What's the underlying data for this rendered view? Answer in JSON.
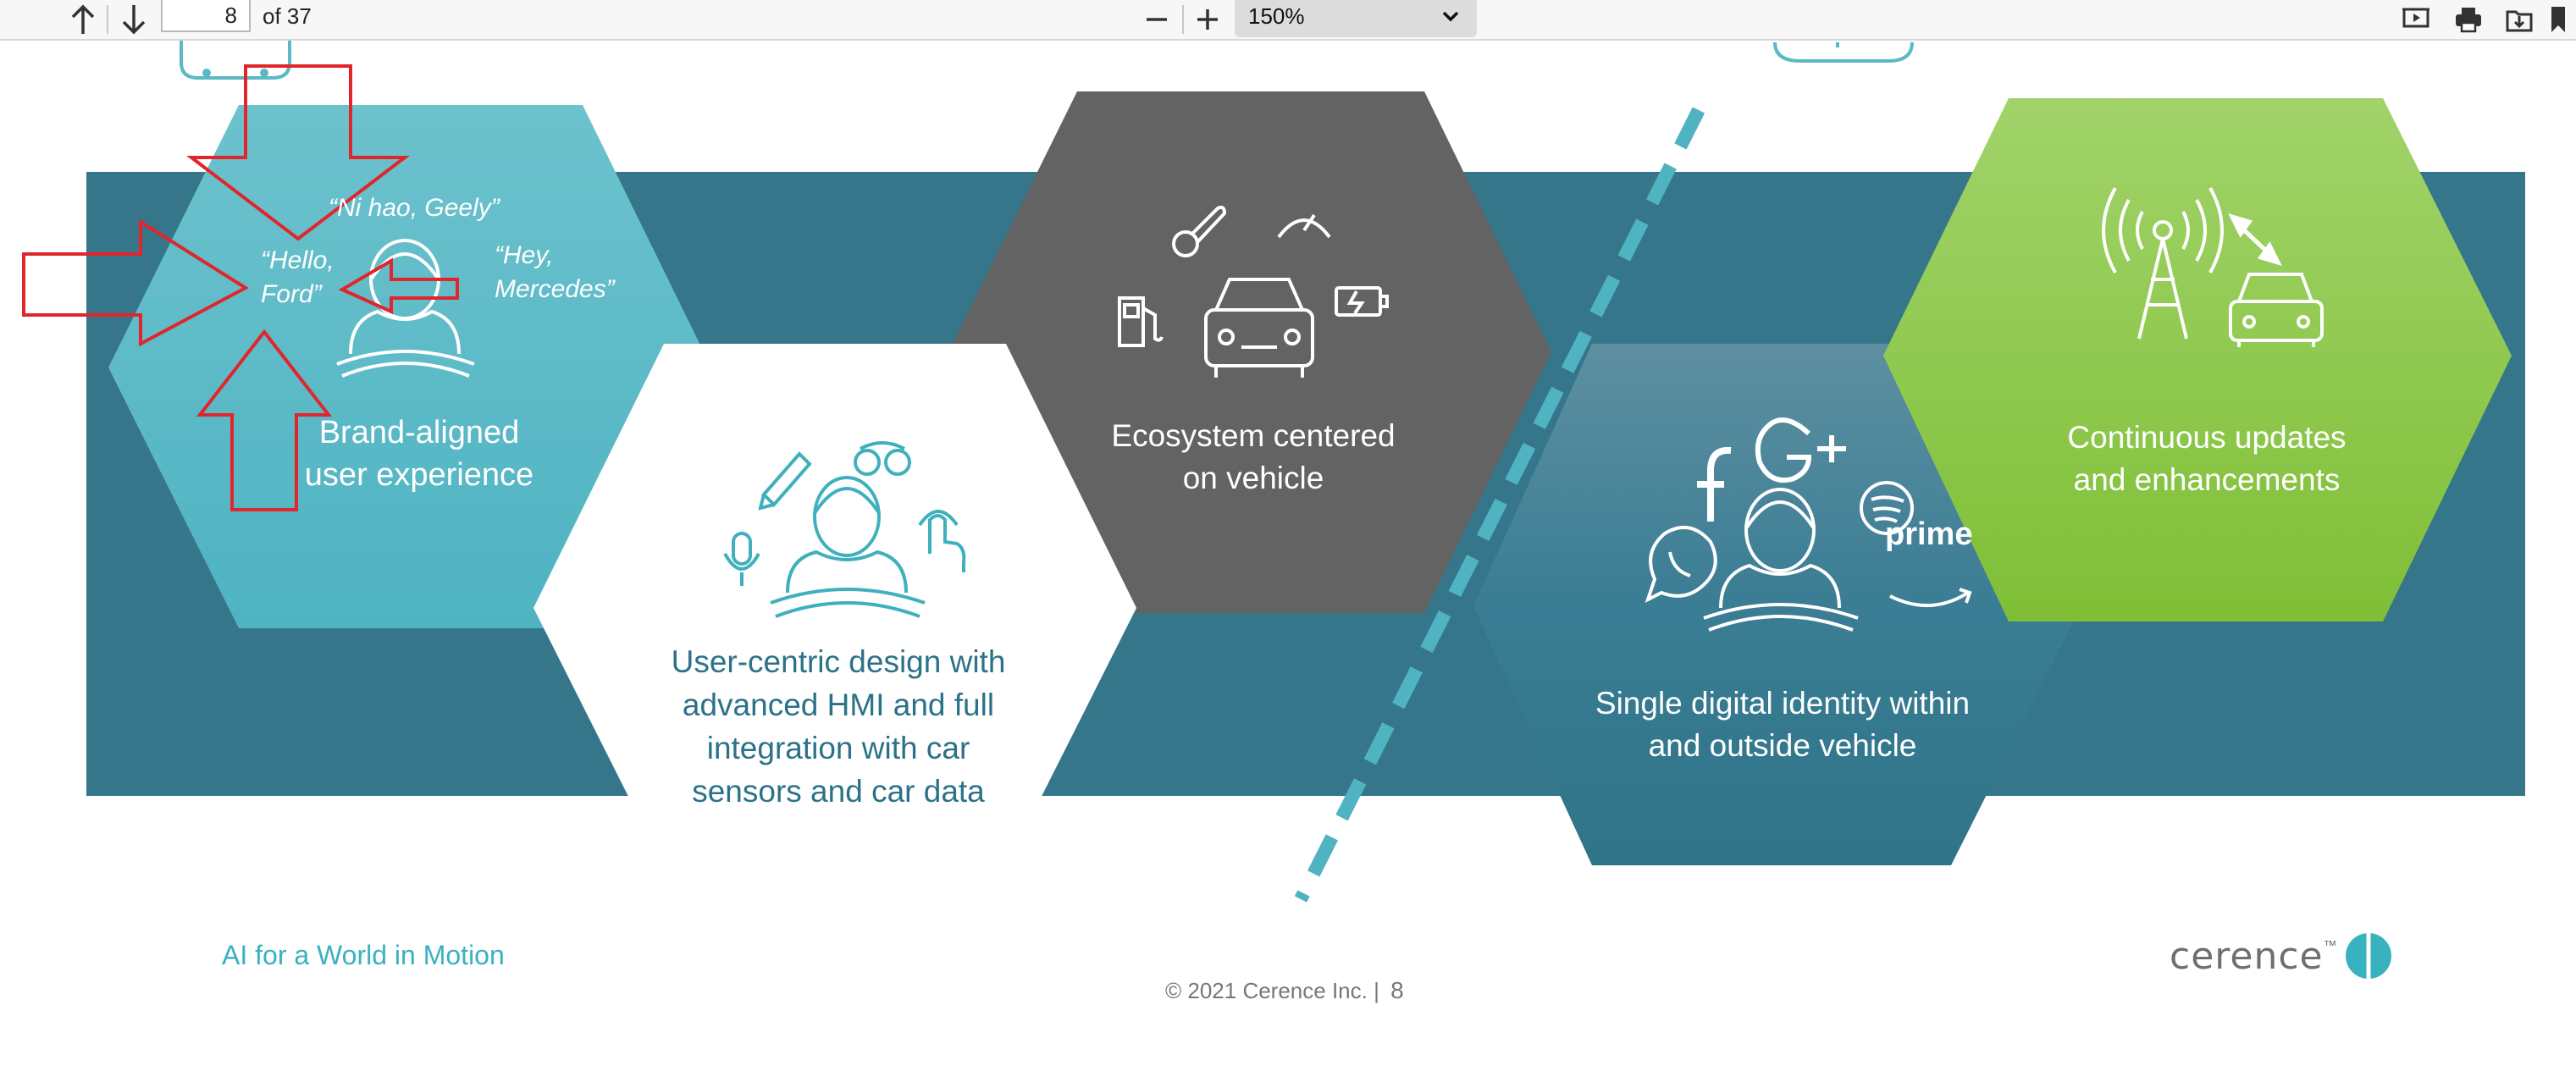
{
  "toolbar": {
    "page_current": "8",
    "page_of": "of 37",
    "zoom": "150%",
    "icons": [
      "arrow-up-icon",
      "arrow-down-icon",
      "zoom-out-icon",
      "zoom-in-icon",
      "chevron-down-icon",
      "presentation-icon",
      "print-icon",
      "save-icon",
      "bookmark-icon"
    ]
  },
  "slide": {
    "hex1": {
      "line1": "Brand-aligned",
      "line2": "user experience"
    },
    "quotes": {
      "geely": "“Ni hao, Geely”",
      "ford_1": "“Hello,",
      "ford_2": "Ford”",
      "mercedes_1": "“Hey,",
      "mercedes_2": "Mercedes”"
    },
    "hex2": {
      "line1": "User-centric design with",
      "line2": "advanced HMI and full",
      "line3": "integration with car",
      "line4": "sensors and car data"
    },
    "hex3": {
      "line1": "Ecosystem centered",
      "line2": "on vehicle"
    },
    "hex4": {
      "line1": "Single digital identity within",
      "line2": "and outside vehicle",
      "prime_label": "prime"
    },
    "hex5": {
      "line1": "Continuous updates",
      "line2": "and enhancements"
    },
    "footer_tagline": "AI for a World in Motion",
    "copyright": "© 2021 Cerence Inc.  |",
    "page_number": "8",
    "logo_text": "cerence",
    "logo_tm": "™"
  },
  "colors": {
    "band": "#36768a",
    "hex1": "#5bb8c5",
    "hex3": "#636363",
    "hex4": "#3a7d94",
    "hex5": "#8cc63f",
    "annotation": "#e0262b",
    "tagline": "#39b2c0"
  }
}
